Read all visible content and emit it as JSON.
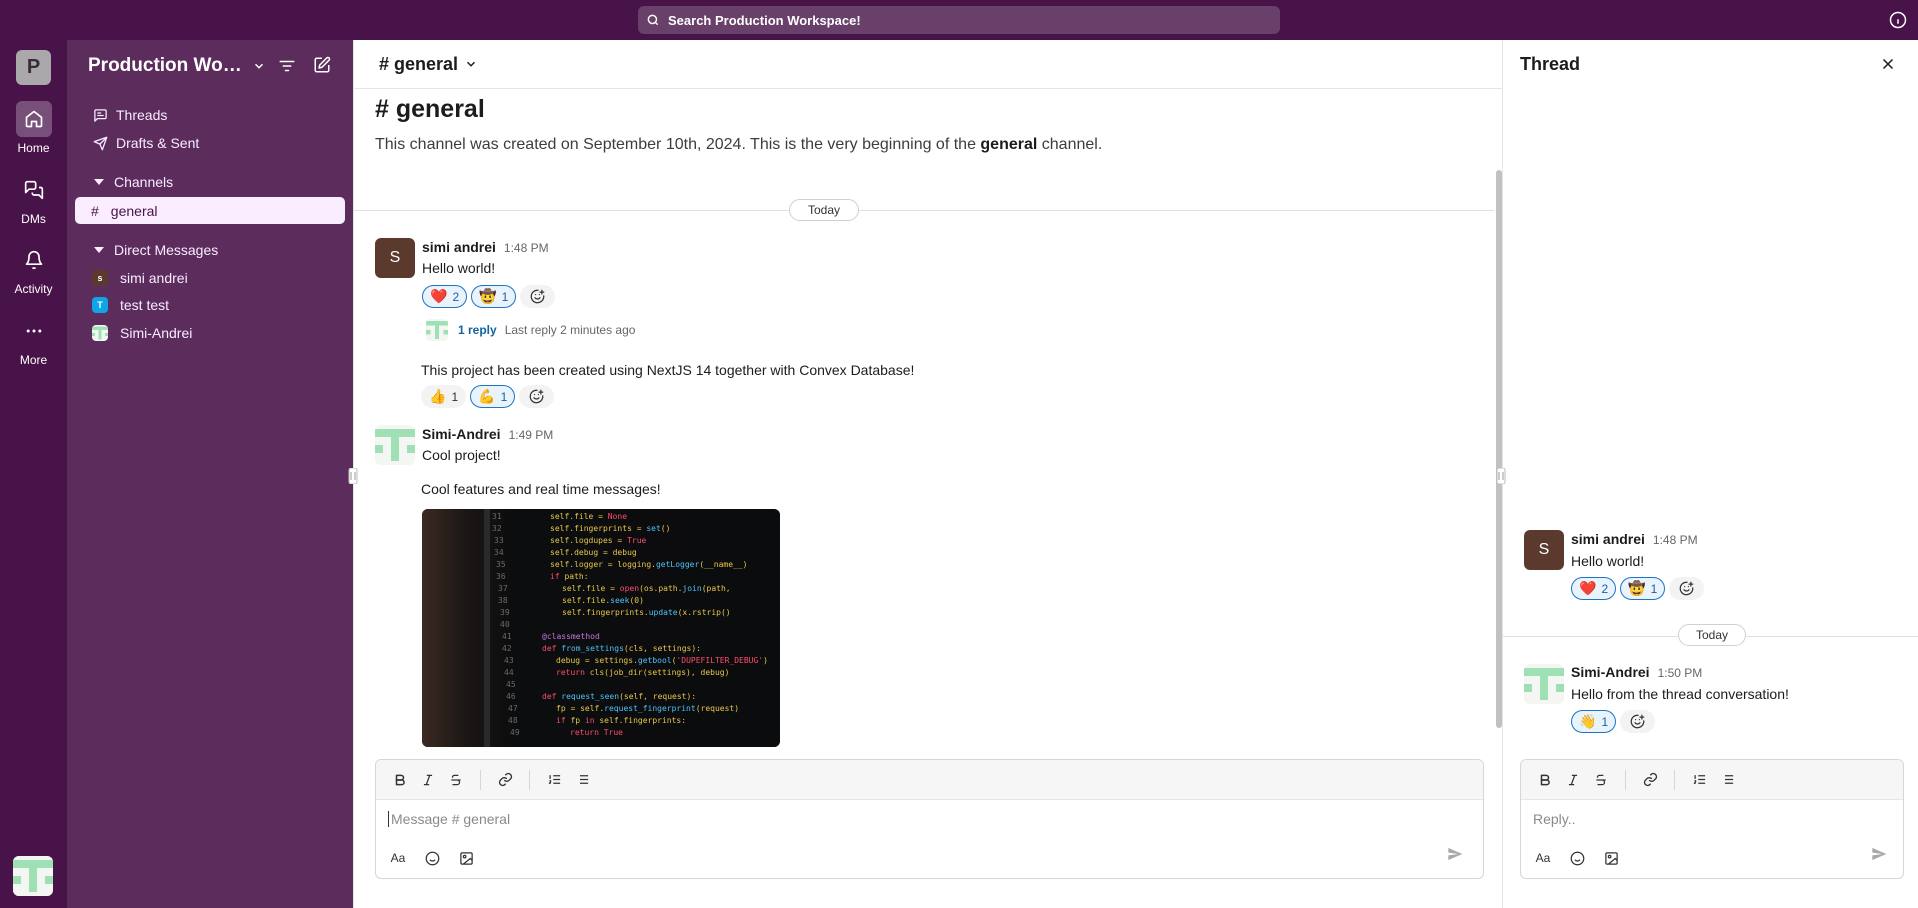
{
  "colors": {
    "aubergine": "#481349",
    "sidebar": "#5c2c5d",
    "link": "#1264a3",
    "reaction_mine": "#1d74c4"
  },
  "topbar": {
    "search_placeholder": "Search Production Workspace!"
  },
  "rail": {
    "workspace_initial": "P",
    "items": [
      {
        "label": "Home",
        "icon": "home-icon",
        "active": true
      },
      {
        "label": "DMs",
        "icon": "message-square-icon",
        "active": false
      },
      {
        "label": "Activity",
        "icon": "bell-icon",
        "active": false
      },
      {
        "label": "More",
        "icon": "ellipsis-icon",
        "active": false
      }
    ]
  },
  "sidebar": {
    "workspace_name": "Production Workspace!",
    "nav": [
      {
        "label": "Threads",
        "icon": "message-square-text-icon"
      },
      {
        "label": "Drafts & Sent",
        "icon": "send-icon"
      }
    ],
    "channels_label": "Channels",
    "channels": [
      {
        "label": "general",
        "active": true
      }
    ],
    "dm_label": "Direct Messages",
    "dms": [
      {
        "name": "simi andrei",
        "initial": "s",
        "color": "#5b3a2d"
      },
      {
        "name": "test test",
        "initial": "T",
        "color": "#0ea5e9"
      },
      {
        "name": "Simi-Andrei",
        "initial": "",
        "color": "#f3f6f3"
      }
    ]
  },
  "channel": {
    "header": "# general",
    "title": "# general",
    "desc_prefix": "This channel was created on September 10th, 2024. This is the very beginning of the ",
    "desc_bold": "general",
    "desc_suffix": " channel.",
    "day_label": "Today"
  },
  "messages": [
    {
      "author": "simi andrei",
      "initial": "S",
      "time": "1:48 PM",
      "text": "Hello world!",
      "reactions": [
        {
          "emoji": "❤️",
          "count": "2",
          "mine": true
        },
        {
          "emoji": "🤠",
          "count": "1",
          "mine": true
        }
      ],
      "thread": {
        "count": "1 reply",
        "last": "Last reply 2 minutes ago"
      }
    },
    {
      "text": "This project has been created using NextJS 14 together with Convex Database!",
      "reactions": [
        {
          "emoji": "👍",
          "count": "1",
          "mine": false
        },
        {
          "emoji": "💪",
          "count": "1",
          "mine": true
        }
      ]
    },
    {
      "author": "Simi-Andrei",
      "time": "1:49 PM",
      "text": "Cool project!"
    },
    {
      "text": "Cool features and real time messages!",
      "image": "code-screenshot"
    }
  ],
  "composer": {
    "placeholder": "Message # general"
  },
  "thread": {
    "title": "Thread",
    "parent": {
      "author": "simi andrei",
      "initial": "S",
      "time": "1:48 PM",
      "text": "Hello world!",
      "reactions": [
        {
          "emoji": "❤️",
          "count": "2",
          "mine": true
        },
        {
          "emoji": "🤠",
          "count": "1",
          "mine": true
        }
      ]
    },
    "day_label": "Today",
    "reply": {
      "author": "Simi-Andrei",
      "time": "1:50 PM",
      "text": "Hello from the thread conversation!",
      "reactions": [
        {
          "emoji": "👋",
          "count": "1",
          "mine": true
        }
      ]
    },
    "composer_placeholder": "Reply.."
  }
}
